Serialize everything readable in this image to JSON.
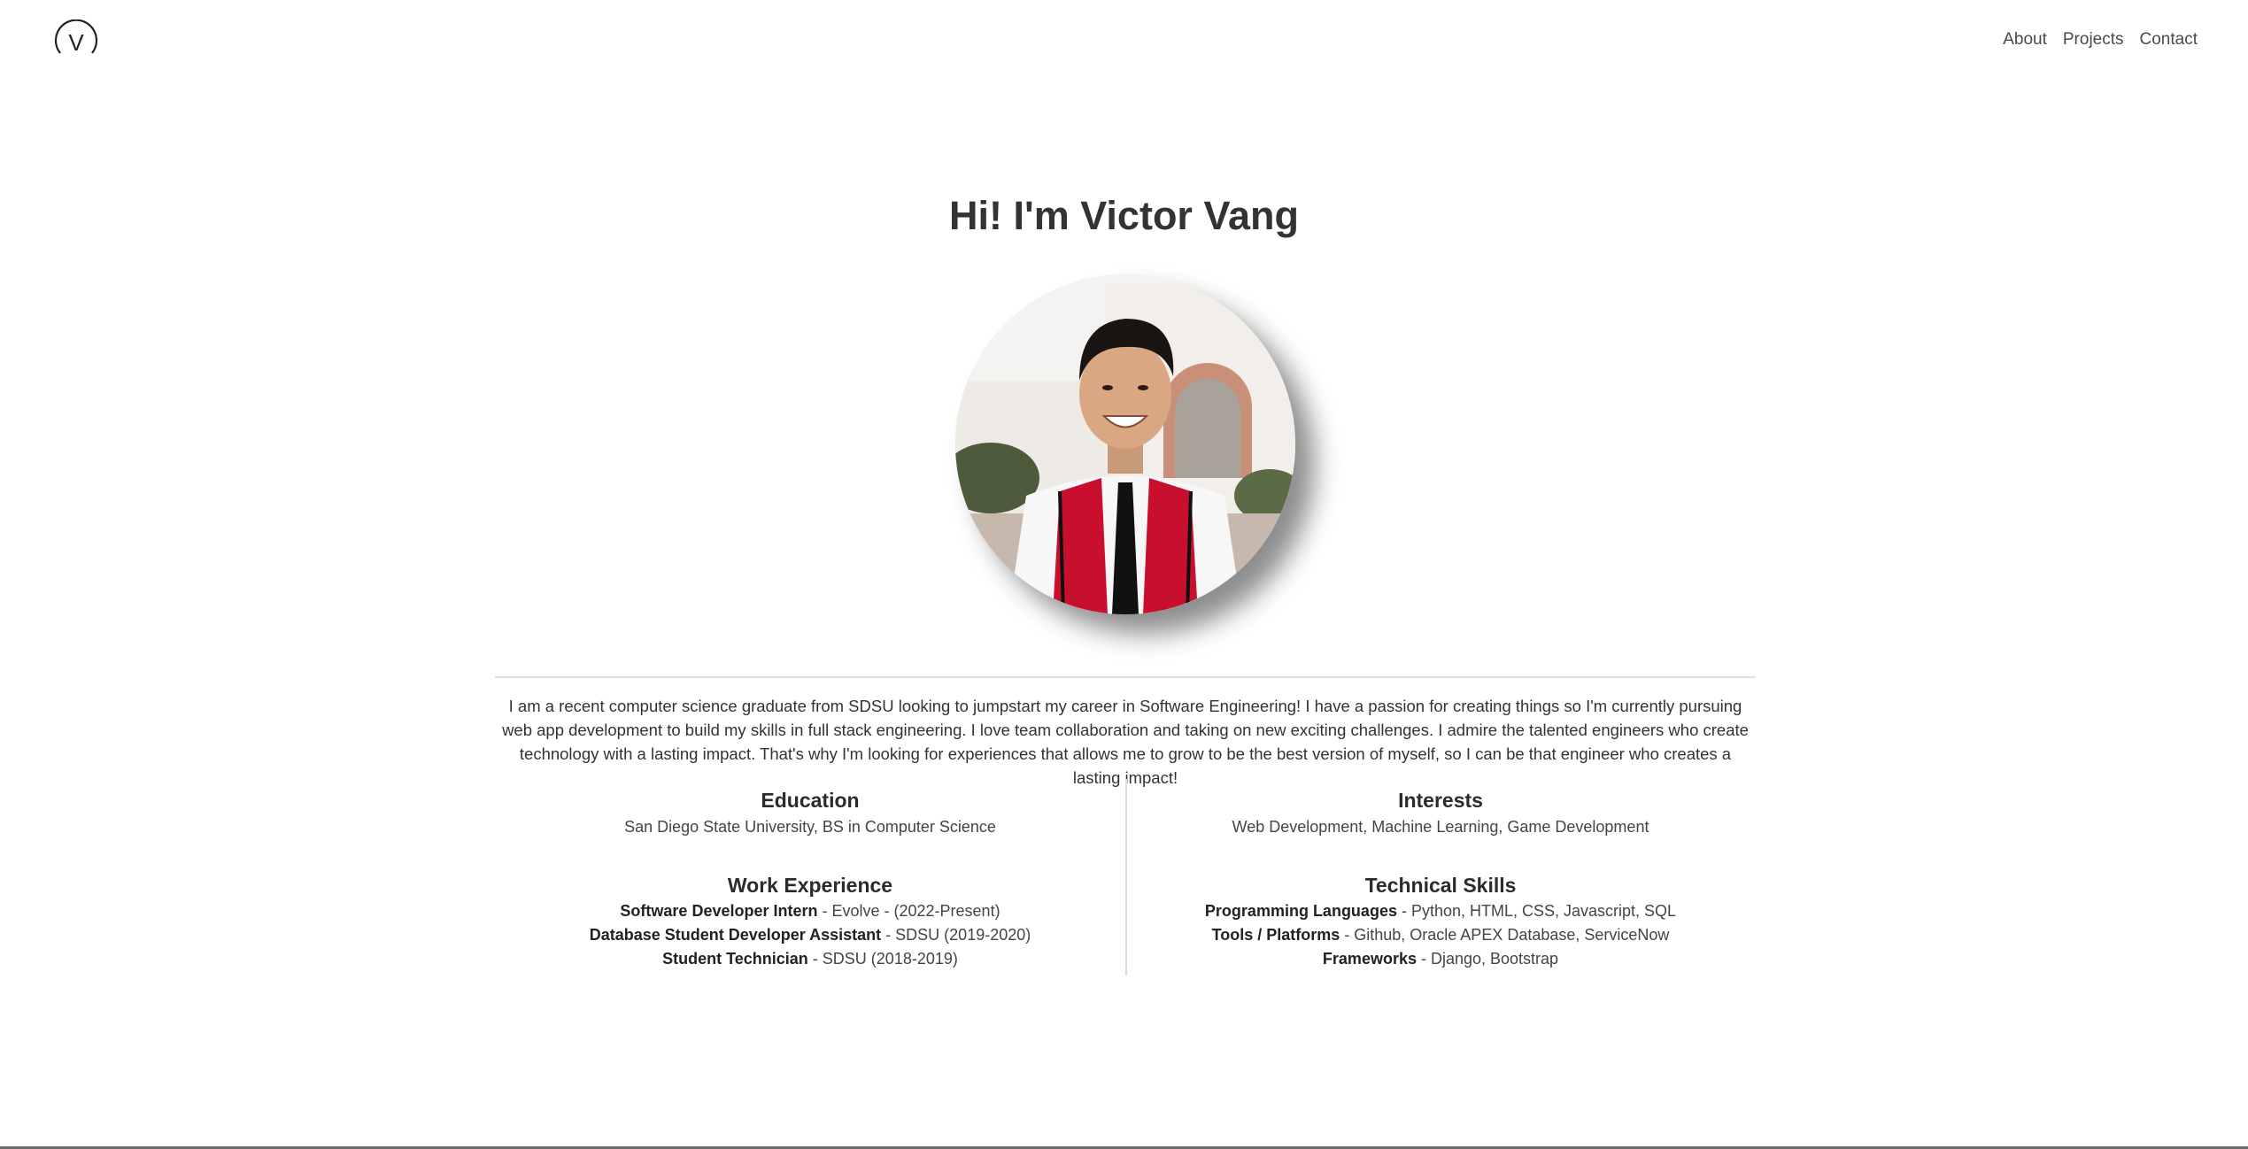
{
  "header": {
    "logo_letter": "V",
    "nav": [
      {
        "label": "About"
      },
      {
        "label": "Projects"
      },
      {
        "label": "Contact"
      }
    ]
  },
  "hero": {
    "title": "Hi! I'm Victor Vang",
    "photo_icon": "profile-photo"
  },
  "bio": "I am a recent computer science graduate from SDSU looking to jumpstart my career in Software Engineering! I have a passion for creating things so I'm currently pursuing web app development to build my skills in full stack engineering. I love team collaboration and taking on new exciting challenges. I admire the talented engineers who create technology with a lasting impact. That's why I'm looking for experiences that allows me to grow to be the best version of myself, so I can be that engineer who creates a lasting impact!",
  "education": {
    "title": "Education",
    "text": "San Diego State University, BS in Computer Science"
  },
  "interests": {
    "title": "Interests",
    "text": "Web Development, Machine Learning, Game Development"
  },
  "work": {
    "title": "Work Experience",
    "items": [
      {
        "role": "Software Developer Intern",
        "detail": " - Evolve - (2022-Present)"
      },
      {
        "role": "Database Student Developer Assistant",
        "detail": " - SDSU (2019-2020)"
      },
      {
        "role": "Student Technician",
        "detail": " - SDSU (2018-2019)"
      }
    ]
  },
  "skills": {
    "title": "Technical Skills",
    "items": [
      {
        "label": "Programming Languages",
        "detail": " - Python, HTML, CSS, Javascript, SQL"
      },
      {
        "label": "Tools / Platforms",
        "detail": " - Github, Oracle APEX Database, ServiceNow"
      },
      {
        "label": "Frameworks",
        "detail": " - Django, Bootstrap"
      }
    ]
  },
  "colors": {
    "text": "#333333",
    "accent_red": "#c8102e",
    "divider": "#dedede"
  }
}
